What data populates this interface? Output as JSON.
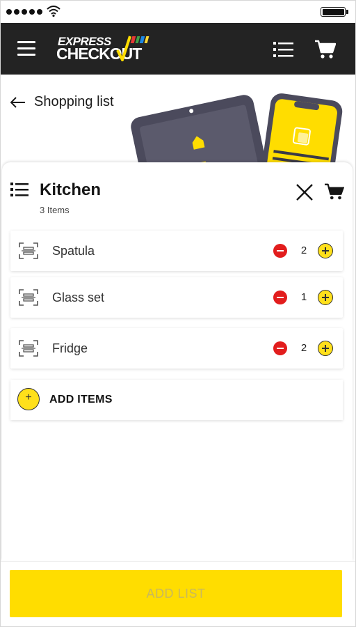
{
  "app": {
    "logo_line1": "EXPRESS",
    "logo_line2": "CHECKOUT",
    "brand_colors": [
      "#e53935",
      "#43a047",
      "#1e88e5",
      "#fdd835"
    ],
    "accent": "#ffdd00",
    "appbar_bg": "#232323"
  },
  "header": {
    "back_label": "Shopping list"
  },
  "list": {
    "title": "Kitchen",
    "count_label": "3 Items",
    "items": [
      {
        "name": "Spatula",
        "qty": "2"
      },
      {
        "name": "Glass set",
        "qty": "1"
      },
      {
        "name": "Fridge",
        "qty": "2"
      }
    ],
    "add_items_label": "ADD ITEMS",
    "add_items_icon": "+"
  },
  "footer": {
    "add_list_label": "ADD LIST"
  },
  "icons": {
    "menu": "hamburger-menu-icon",
    "list": "list-icon",
    "cart": "cart-icon",
    "back": "arrow-left-icon",
    "close": "close-icon",
    "scan": "barcode-scan-icon",
    "minus": "minus-circle-icon",
    "plus": "plus-circle-icon"
  }
}
